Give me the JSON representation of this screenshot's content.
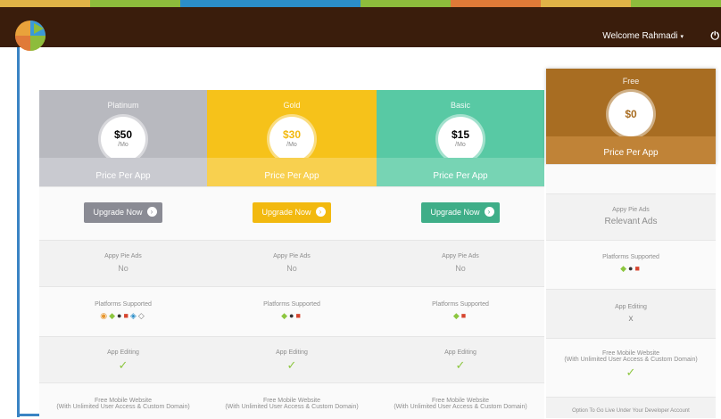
{
  "header": {
    "stripe_colors": [
      "#e0b347",
      "#8dbc3c",
      "#2b8ec9",
      "#2b8ec9",
      "#8dbc3c",
      "#e07a38",
      "#e0b347",
      "#8dbc3c"
    ],
    "welcome_text": "Welcome Rahmadi",
    "caret": "▾",
    "power_glyph": "⏻"
  },
  "plans": [
    {
      "name": "Platinum",
      "price": "$50",
      "per": "/Mo",
      "price_per_app": "Price Per App",
      "upgrade_label": "Upgrade Now",
      "arrow": "›",
      "color_head": "#b8b9bf",
      "color_band": "#c9cad0",
      "color_btn": "#8a8b94",
      "features": {
        "ads_label": "Appy Pie Ads",
        "ads_value": "No",
        "platforms_label": "Platforms Supported",
        "platform_icons": "◉ ◆ ● ■ ◈ ◇",
        "editing_label": "App Editing",
        "editing_value": "✓",
        "website_label": "Free Mobile Website",
        "website_sub": "(With Unlimited User Access & Custom Domain)"
      }
    },
    {
      "name": "Gold",
      "price": "$30",
      "per": "/Mo",
      "price_per_app": "Price Per App",
      "upgrade_label": "Upgrade Now",
      "arrow": "›",
      "color_head": "#f6c21a",
      "color_band": "#f8d04f",
      "color_btn": "#f2b90f",
      "features": {
        "ads_label": "Appy Pie Ads",
        "ads_value": "No",
        "platforms_label": "Platforms Supported",
        "platform_icons": "◆ ● ■",
        "editing_label": "App Editing",
        "editing_value": "✓",
        "website_label": "Free Mobile Website",
        "website_sub": "(With Unlimited User Access & Custom Domain)"
      }
    },
    {
      "name": "Basic",
      "price": "$15",
      "per": "/Mo",
      "price_per_app": "Price Per App",
      "upgrade_label": "Upgrade Now",
      "arrow": "›",
      "color_head": "#58c9a4",
      "color_band": "#77d4b4",
      "color_btn": "#3fae88",
      "features": {
        "ads_label": "Appy Pie Ads",
        "ads_value": "No",
        "platforms_label": "Platforms Supported",
        "platform_icons": "◆ ■",
        "editing_label": "App Editing",
        "editing_value": "✓",
        "website_label": "Free Mobile Website",
        "website_sub": "(With Unlimited User Access & Custom Domain)"
      }
    },
    {
      "name": "Free",
      "price": "$0",
      "price_per_app": "Price Per App",
      "color_head": "#a86d22",
      "color_band": "#c08337",
      "features": {
        "ads_label": "Appy Pie Ads",
        "ads_value": "Relevant Ads",
        "platforms_label": "Platforms Supported",
        "platform_icons": "◆ ● ■",
        "editing_label": "App Editing",
        "editing_value": "x",
        "website_label": "Free Mobile Website",
        "website_sub": "(With Unlimited User Access & Custom Domain)",
        "website_check": "✓",
        "golive_label": "Option To Go Live Under Your Developer Account"
      }
    }
  ]
}
